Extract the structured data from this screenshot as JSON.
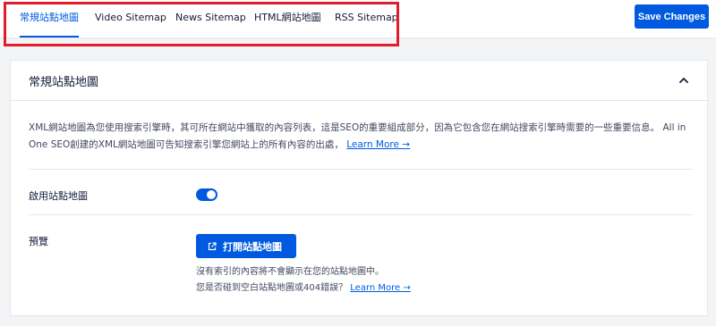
{
  "tabs": [
    {
      "label": "常規站點地圖",
      "active": true
    },
    {
      "label": "Video Sitemap",
      "active": false
    },
    {
      "label": "News Sitemap",
      "active": false
    },
    {
      "label": "HTML網站地圖",
      "active": false
    },
    {
      "label": "RSS Sitemap",
      "active": false
    }
  ],
  "toolbar": {
    "save_label": "Save Changes"
  },
  "section": {
    "title": "常規站點地圖",
    "description_line1": "XML網站地圖為您使用搜索引擎時，其可所在網站中獲取的內容列表，這是SEO的重要組成部分，因為它包含您在網站搜索引擎時需要的一些重要信息。 All in",
    "description_line2": "One SEO創建的XML網站地圖可告知搜索引擎您網站上的所有內容的出處，",
    "learn_more": "Learn More →",
    "enable_label": "啟用站點地圖",
    "enable_on": true,
    "preview_label": "預覽",
    "open_button": "打開站點地圖",
    "note_line1": "沒有索引的內容將不會顯示在您的站點地圖中。",
    "note_line2": "您是否碰到空白站點地圖或404錯誤？",
    "note_link": "Learn More →"
  },
  "colors": {
    "accent": "#005ae0",
    "highlight": "#e01e2b",
    "text": "#141b38",
    "muted": "#434960"
  }
}
